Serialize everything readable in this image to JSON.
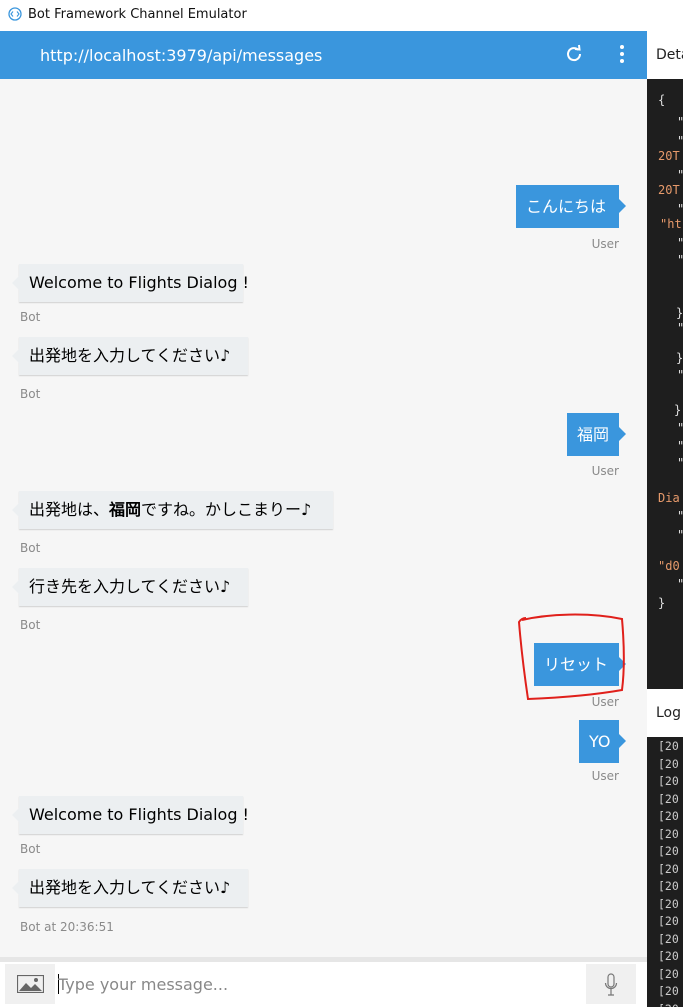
{
  "window": {
    "title": "Bot Framework Channel Emulator"
  },
  "header": {
    "url": "http://localhost:3979/api/messages"
  },
  "messages": [
    {
      "from": "user",
      "text": "こんにちは",
      "meta": "User"
    },
    {
      "from": "bot",
      "text": "Welcome to Flights Dialog !",
      "meta": "Bot"
    },
    {
      "from": "bot",
      "text": "出発地を入力してください♪",
      "meta": "Bot"
    },
    {
      "from": "user",
      "text": "福岡",
      "meta": "User"
    },
    {
      "from": "bot",
      "text_before": "出発地は、",
      "text_bold": "福岡",
      "text_after": "ですね。かしこまりー♪",
      "meta": "Bot"
    },
    {
      "from": "bot",
      "text": "行き先を入力してください♪",
      "meta": "Bot"
    },
    {
      "from": "user",
      "text": "リセット",
      "meta": "User"
    },
    {
      "from": "user",
      "text": "YO",
      "meta": "User"
    },
    {
      "from": "bot",
      "text": "Welcome to Flights Dialog !",
      "meta": "Bot"
    },
    {
      "from": "bot",
      "text": "出発地を入力してください♪",
      "meta": "Bot at 20:36:51"
    }
  ],
  "input": {
    "placeholder": "Type your message..."
  },
  "details_panel": {
    "title": "Deta",
    "lines": [
      "{",
      "\"",
      "\"",
      "20T",
      "\"",
      "20T",
      "\"",
      "\"ht",
      "\"",
      "\"",
      "}",
      "\"",
      "}",
      "\"",
      "}",
      "\"",
      "\"",
      "\"",
      "Dia",
      "\"",
      "\"",
      "\"d0",
      "\"",
      "}"
    ]
  },
  "log_panel": {
    "title": "Log",
    "lines": [
      "[20",
      "[20",
      "[20",
      "[20",
      "[20",
      "[20",
      "[20",
      "[20",
      "[20",
      "[20",
      "[20",
      "[20",
      "[20",
      "[20",
      "[20",
      "[20",
      "[20"
    ]
  },
  "colors": {
    "accent": "#3a96dd",
    "annotation": "#e0201b"
  }
}
